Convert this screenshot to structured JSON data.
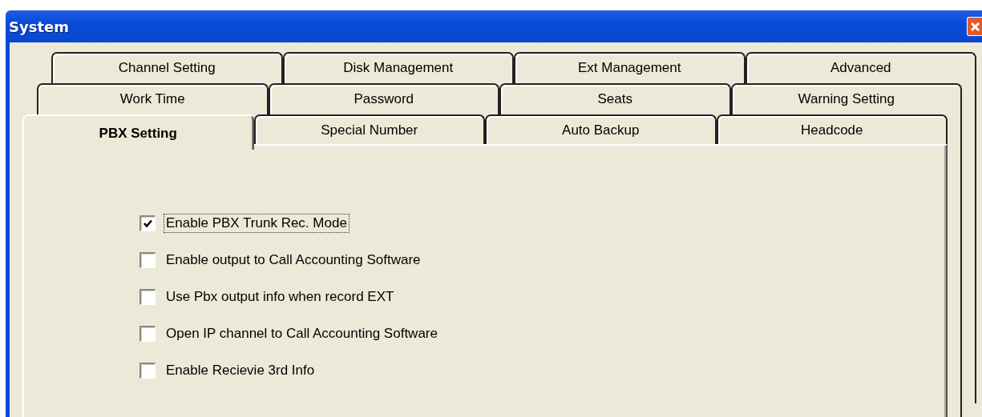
{
  "window": {
    "title": "System"
  },
  "tab_rows": [
    {
      "tabs": [
        {
          "label": "Channel Setting",
          "selected": false
        },
        {
          "label": "Disk Management",
          "selected": false
        },
        {
          "label": "Ext Management",
          "selected": false
        },
        {
          "label": "Advanced",
          "selected": false
        }
      ]
    },
    {
      "tabs": [
        {
          "label": "Work Time",
          "selected": false
        },
        {
          "label": "Password",
          "selected": false
        },
        {
          "label": "Seats",
          "selected": false
        },
        {
          "label": "Warning Setting",
          "selected": false
        }
      ]
    },
    {
      "tabs": [
        {
          "label": "PBX Setting",
          "selected": true
        },
        {
          "label": "Special Number",
          "selected": false
        },
        {
          "label": "Auto Backup",
          "selected": false
        },
        {
          "label": "Headcode",
          "selected": false
        }
      ]
    }
  ],
  "options": [
    {
      "label": "Enable PBX Trunk Rec. Mode",
      "checked": true,
      "focused": true
    },
    {
      "label": "Enable output to Call Accounting Software",
      "checked": false,
      "focused": false
    },
    {
      "label": "Use Pbx output info when record EXT",
      "checked": false,
      "focused": false
    },
    {
      "label": "Open IP channel to Call Accounting Software",
      "checked": false,
      "focused": false
    },
    {
      "label": "Enable Recievie 3rd Info",
      "checked": false,
      "focused": false
    }
  ]
}
